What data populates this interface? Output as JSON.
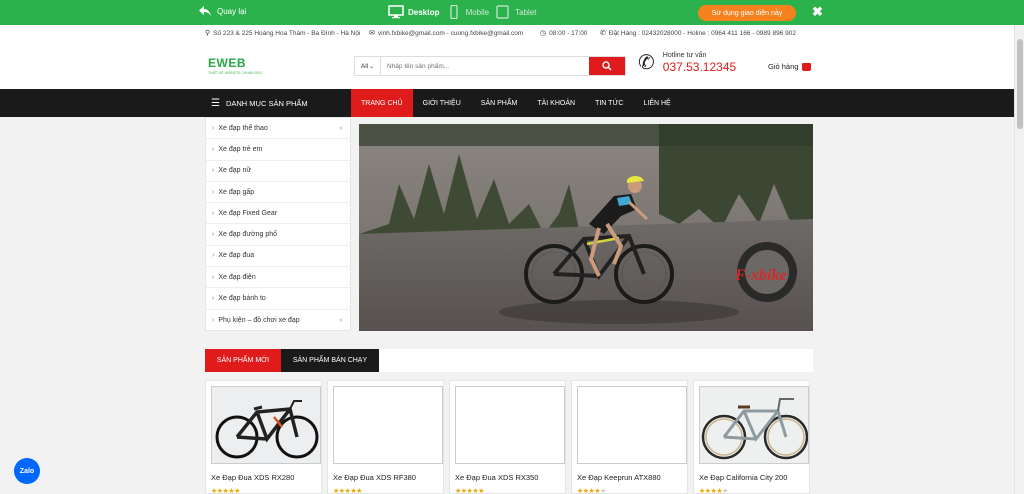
{
  "preview_bar": {
    "back_label": "Quay lại",
    "devices": [
      {
        "label": "Desktop",
        "active": true
      },
      {
        "label": "Mobile",
        "active": false
      },
      {
        "label": "Tablet",
        "active": false
      }
    ],
    "use_button": "Sử dụng giao diện này",
    "close_symbol": "✖",
    "color": "#2bb24c"
  },
  "info_bar": {
    "address": "Số 223 & 225 Hoàng Hoa Thám - Ba Đình - Hà Nội",
    "email": "vinh.fxbike@gmail.com - cuong.fxbike@gmail.com",
    "hours": "08:00 - 17:00",
    "phones": "Đặt Hàng : 02432028000 - Holine : 0964 411 166 - 0989 896 902"
  },
  "header": {
    "logo_text": "EWEB",
    "logo_sub": "THIẾT KẾ WEBSITE CHUẨN SEO",
    "search_category": "All",
    "search_placeholder": "Nhập tên sản phẩm...",
    "hotline_label": "Hotline tư vấn",
    "hotline_number": "037.53.12345",
    "cart_label": "Giỏ hàng",
    "accent_color": "#e01b1b"
  },
  "nav": {
    "category_header": "DANH MỤC SẢN PHẨM",
    "items": [
      {
        "label": "TRANG CHỦ",
        "active": true
      },
      {
        "label": "GIỚI THIỆU",
        "active": false
      },
      {
        "label": "SẢN PHẨM",
        "active": false
      },
      {
        "label": "TÀI KHOẢN",
        "active": false
      },
      {
        "label": "TIN TỨC",
        "active": false
      },
      {
        "label": "LIÊN HỆ",
        "active": false
      }
    ]
  },
  "sidebar": {
    "items": [
      {
        "label": "Xe đạp thể thao",
        "has_sub": true
      },
      {
        "label": "Xe đạp trẻ em",
        "has_sub": false
      },
      {
        "label": "Xe đạp nữ",
        "has_sub": false
      },
      {
        "label": "Xe đạp gấp",
        "has_sub": false
      },
      {
        "label": "Xe đạp Fixed Gear",
        "has_sub": false
      },
      {
        "label": "Xe đạp đường phố",
        "has_sub": false
      },
      {
        "label": "Xe đạp đua",
        "has_sub": false
      },
      {
        "label": "Xe đạp điện",
        "has_sub": false
      },
      {
        "label": "Xe đạp bánh to",
        "has_sub": false
      },
      {
        "label": "Phụ kiện – đồ chơi xe đạp",
        "has_sub": true
      }
    ]
  },
  "banner": {
    "brand": "F-xbike"
  },
  "product_tabs": {
    "new": "SẢN PHẨM MỚI",
    "best": "SẢN PHẨM BÁN CHẠY"
  },
  "products": [
    {
      "name": "Xe Đạp Đua XDS RX280",
      "rating": 5,
      "image": "road-bike-black"
    },
    {
      "name": "Xe Đạp Đua XDS RF380",
      "rating": 5,
      "image": "blank"
    },
    {
      "name": "Xe Đạp Đua XDS RX350",
      "rating": 5,
      "image": "blank"
    },
    {
      "name": "Xe Đạp Keeprun ATX880",
      "rating": 4,
      "image": "blank"
    },
    {
      "name": "Xe Đạp California City 200",
      "rating": 4,
      "image": "city-bike-silver"
    }
  ],
  "zalo_label": "Zalo"
}
